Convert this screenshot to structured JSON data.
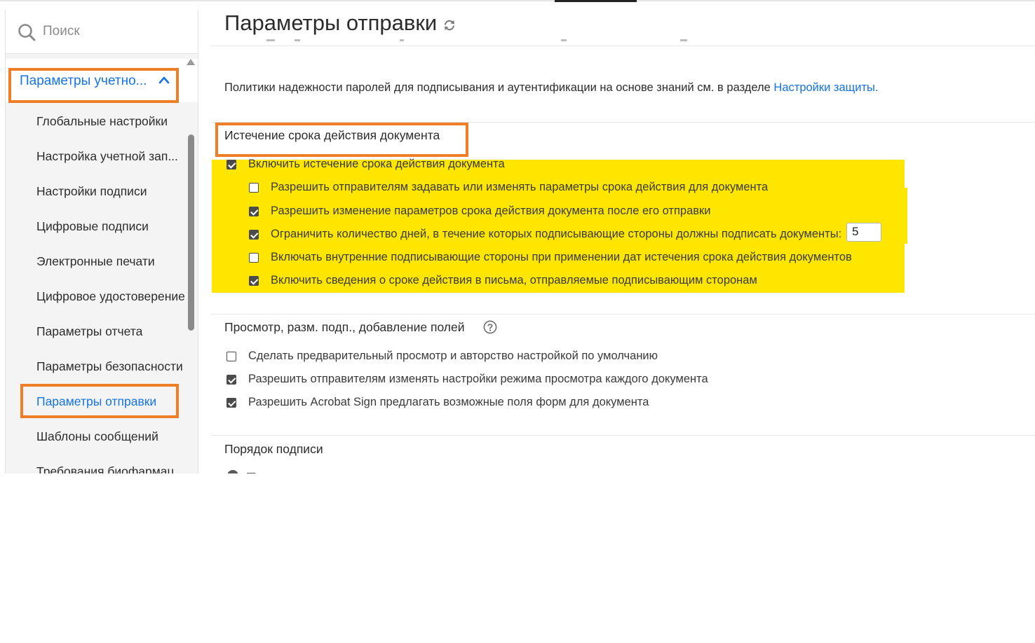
{
  "search": {
    "placeholder": "Поиск"
  },
  "sidebar": {
    "section_label": "Параметры учетно...",
    "items": [
      {
        "label": "Глобальные настройки",
        "active": false
      },
      {
        "label": "Настройка учетной зап...",
        "active": false
      },
      {
        "label": "Настройки подписи",
        "active": false
      },
      {
        "label": "Цифровые подписи",
        "active": false
      },
      {
        "label": "Электронные печати",
        "active": false
      },
      {
        "label": "Цифровое удостоверение",
        "active": false
      },
      {
        "label": "Параметры отчета",
        "active": false
      },
      {
        "label": "Параметры безопасности",
        "active": false
      },
      {
        "label": "Параметры отправки",
        "active": true
      },
      {
        "label": "Шаблоны сообщений",
        "active": false
      },
      {
        "label": "Требования биофармац...",
        "active": false
      }
    ]
  },
  "main": {
    "title": "Параметры отправки",
    "policy_text": "Политики надежности паролей для подписывания и аутентификации на основе знаний см. в разделе ",
    "policy_link": "Настройки защиты",
    "policy_end": ".",
    "expiration": {
      "title": "Истечение срока действия документа",
      "enable": {
        "label": "Включить истечение срока действия документа",
        "checked": true
      },
      "options": [
        {
          "label": "Разрешить отправителям задавать или изменять параметры срока действия для документа",
          "checked": false
        },
        {
          "label": "Разрешить изменение параметров срока действия документа после его отправки",
          "checked": true
        },
        {
          "label": "Ограничить количество дней, в течение которых подписывающие стороны должны подписать документы:",
          "checked": true
        },
        {
          "label": "Включать внутренние подписывающие стороны при применении дат истечения срока действия документов",
          "checked": false
        },
        {
          "label": "Включить сведения о сроке действия в письма, отправляемые подписывающим сторонам",
          "checked": true
        }
      ],
      "days_value": "5"
    },
    "preview": {
      "title": "Просмотр, разм. подп., добавление полей",
      "options": [
        {
          "label": "Сделать предварительный просмотр и авторство настройкой по умолчанию",
          "checked": false
        },
        {
          "label": "Разрешить отправителям изменять настройки режима просмотра каждого документа",
          "checked": true
        },
        {
          "label": "Разрешить Acrobat Sign предлагать возможные поля форм для документа",
          "checked": true
        }
      ]
    },
    "signing_order": {
      "title": "Порядок подписи"
    }
  },
  "colors": {
    "accent": "#1473e6",
    "highlight": "#ffe600",
    "annotation": "#f07e27"
  }
}
